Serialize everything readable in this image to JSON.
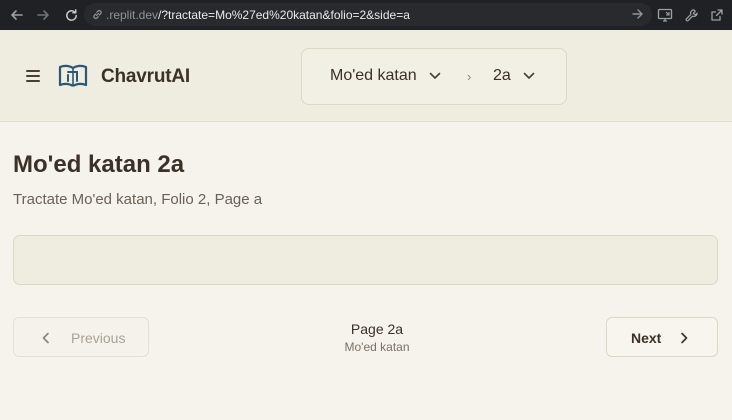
{
  "browser": {
    "url_host": ".replit.dev",
    "url_path": "/?tractate=Mo%27ed%20katan&folio=2&side=a",
    "icons": [
      "back-icon",
      "forward-icon",
      "reload-icon",
      "link-icon",
      "go-arrow-icon",
      "cast-icon",
      "wrench-icon",
      "open-external-icon"
    ]
  },
  "header": {
    "brand": "ChavrutAI",
    "tractate_selector": {
      "value": "Mo'ed katan"
    },
    "separator": "›",
    "folio_selector": {
      "value": "2a"
    }
  },
  "main": {
    "title": "Mo'ed katan 2a",
    "subtitle": "Tractate Mo'ed katan, Folio 2, Page a",
    "text_content": ""
  },
  "pagination": {
    "previous_label": "Previous",
    "next_label": "Next",
    "page_label": "Page 2a",
    "tractate_label": "Mo'ed katan"
  },
  "colors": {
    "background": "#f5f3ec",
    "header_bg": "#efece0",
    "text_primary": "#3b3128",
    "brand_accent": "#2c5875"
  }
}
